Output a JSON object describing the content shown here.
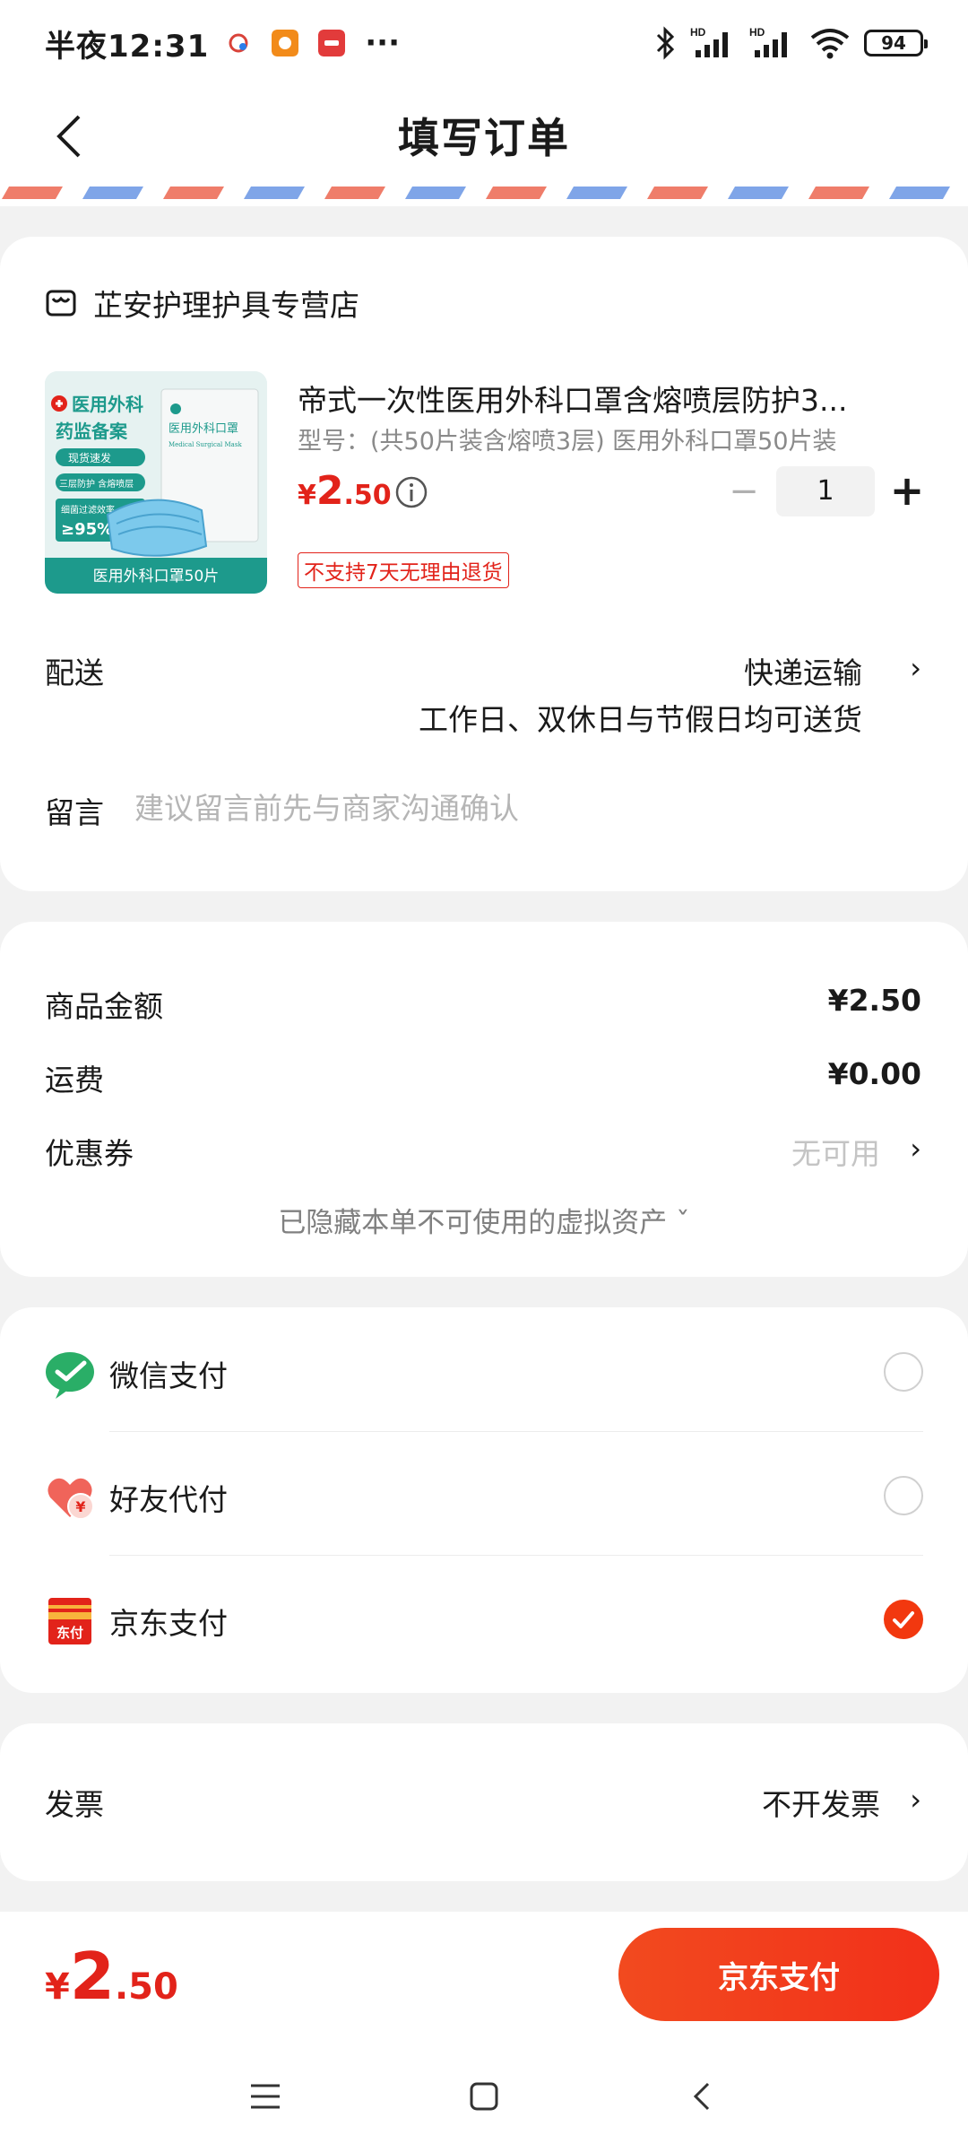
{
  "status_bar": {
    "time": "半夜12:31",
    "more": "···",
    "battery": "94"
  },
  "header": {
    "title": "填写订单"
  },
  "store": {
    "name": "芷安护理护具专营店"
  },
  "product": {
    "title": "帝式一次性医用外科口罩含熔喷层防护3...",
    "spec": "型号：(共50片装含熔喷3层) 医用外科口罩50片装",
    "price_symbol": "¥",
    "price_int": "2",
    "price_dec": ".50",
    "quantity": "1",
    "qty_minus": "−",
    "qty_plus": "+",
    "return_policy": "不支持7天无理由退货",
    "image_texts": {
      "line1": "医用外科",
      "line2": "药监备案",
      "tag1": "现货速发",
      "tag2": "三层防护 含熔喷层",
      "tag3": "细菌过滤效率",
      "efficiency": "≥95%",
      "pack_cn": "医用外科口罩",
      "pack_en": "Medical Surgical Mask",
      "footer": "医用外科口罩50片"
    }
  },
  "delivery": {
    "label": "配送",
    "method": "快递运输",
    "note": "工作日、双休日与节假日均可送货"
  },
  "message": {
    "label": "留言",
    "placeholder": "建议留言前先与商家沟通确认"
  },
  "amounts": {
    "goods_label": "商品金额",
    "goods_value": "¥2.50",
    "shipping_label": "运费",
    "shipping_value": "¥0.00",
    "coupon_label": "优惠券",
    "coupon_value": "无可用",
    "hidden_assets": "已隐藏本单不可使用的虚拟资产 ˇ"
  },
  "payment": {
    "methods": [
      {
        "label": "微信支付",
        "icon": "wechat-pay-icon",
        "selected": false
      },
      {
        "label": "好友代付",
        "icon": "friend-pay-icon",
        "selected": false
      },
      {
        "label": "京东支付",
        "icon": "jd-pay-icon",
        "selected": true
      }
    ],
    "jd_icon_text": "东付"
  },
  "invoice": {
    "label": "发票",
    "value": "不开发票"
  },
  "bottom": {
    "total_symbol": "¥",
    "total_int": "2",
    "total_dec": ".50",
    "pay_button": "京东支付"
  },
  "colors": {
    "accent": "#e2231a",
    "button": "#f2380f",
    "wechat": "#2aae67"
  }
}
